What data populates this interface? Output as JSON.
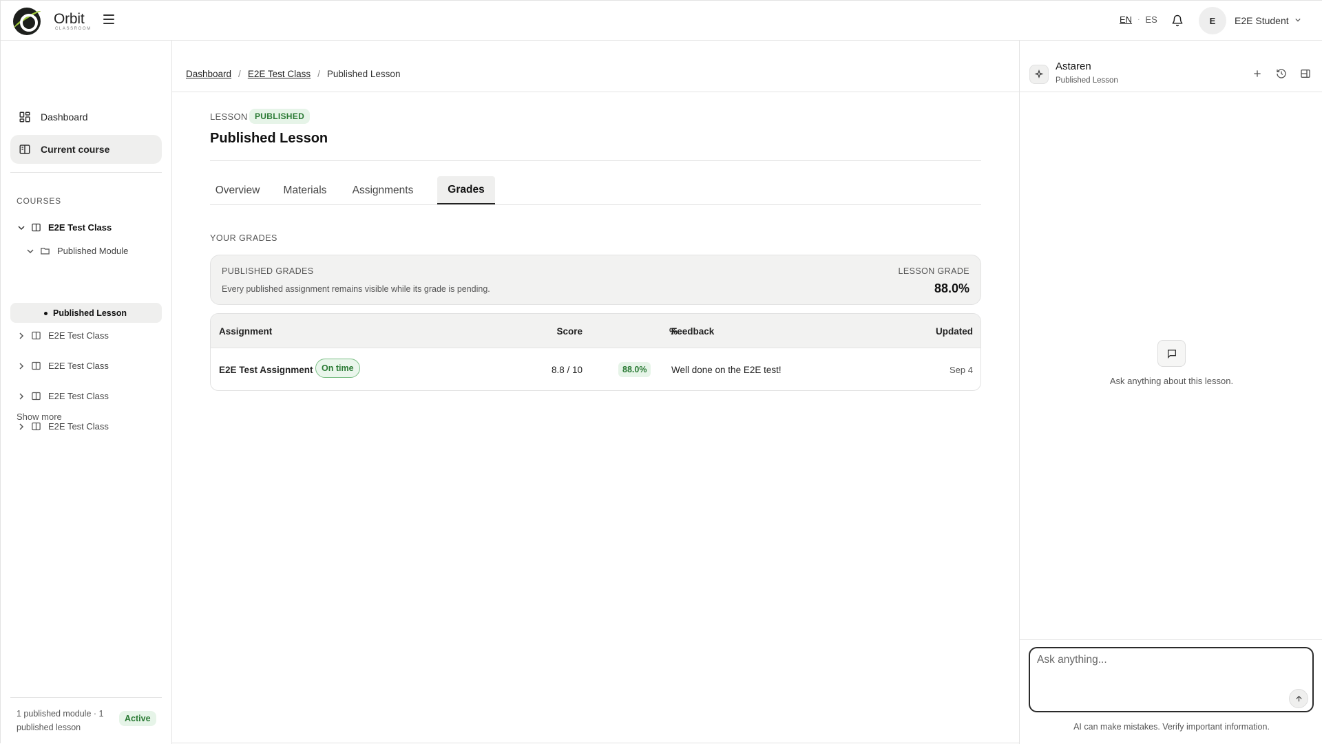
{
  "header": {
    "logo_name": "Orbit",
    "logo_sub": "CLASSROOM",
    "lang_en": "EN",
    "lang_es": "ES",
    "user_initial": "E",
    "user_name": "E2E Student"
  },
  "sidebar": {
    "nav": [
      {
        "label": "Dashboard",
        "icon": "grid-icon"
      },
      {
        "label": "Current course",
        "icon": "book-open-icon"
      }
    ],
    "section_title": "COURSES",
    "tree": {
      "course": "E2E Test Class",
      "module": "Published Module",
      "lesson": "Published Lesson",
      "other_courses": [
        "E2E Test Class",
        "E2E Test Class",
        "E2E Test Class",
        "E2E Test Class"
      ]
    },
    "show_more": "Show more",
    "footer_text": "1 published module · 1 published lesson",
    "footer_badge": "Active"
  },
  "main": {
    "breadcrumb": [
      "Dashboard",
      "E2E Test Class",
      "Published Lesson"
    ],
    "lesson_label": "LESSON",
    "status_badge": "PUBLISHED",
    "title": "Published Lesson",
    "tabs": [
      "Overview",
      "Materials",
      "Assignments",
      "Grades"
    ],
    "active_tab": "Grades",
    "grades_heading": "YOUR GRADES",
    "summary": {
      "title": "PUBLISHED GRADES",
      "description": "Every published assignment remains visible while its grade is pending.",
      "grade_label": "LESSON GRADE",
      "grade_value": "88.0%"
    },
    "table": {
      "headers": [
        "Assignment",
        "Score",
        "%",
        "Feedback",
        "Updated"
      ],
      "rows": [
        {
          "assignment": "E2E Test Assignment",
          "status": "On time",
          "score": "8.8 / 10",
          "percent": "88.0%",
          "feedback": "Well done on the E2E test!",
          "updated": "Sep 4"
        }
      ]
    }
  },
  "assistant": {
    "name": "Astaren",
    "context": "Published Lesson",
    "empty_text": "Ask anything about this lesson.",
    "input_placeholder": "Ask anything...",
    "disclaimer": "AI can make mistakes. Verify important information."
  },
  "colors": {
    "accent_green": "#2a7a34",
    "badge_green_bg": "#e6f4e8",
    "active_bg": "#efefee",
    "logo_green": "#9ec93a"
  }
}
